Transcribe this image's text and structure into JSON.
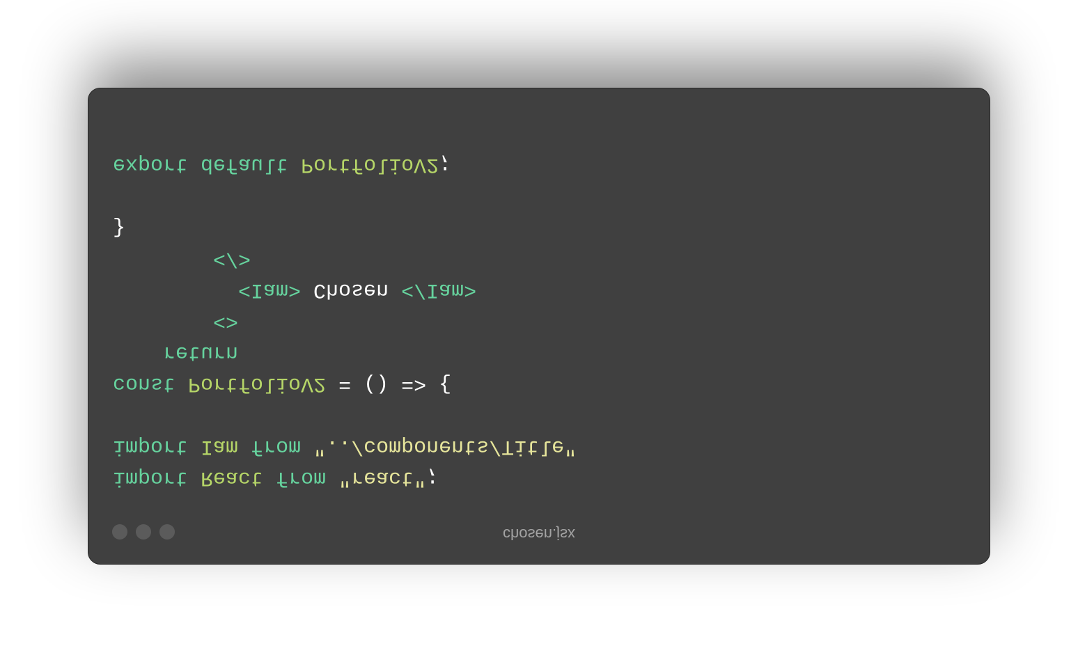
{
  "window": {
    "title": "chosen.jsx"
  },
  "code": {
    "lines": [
      [
        {
          "t": "import",
          "c": "k"
        },
        {
          "t": " "
        },
        {
          "t": "React",
          "c": "i"
        },
        {
          "t": " "
        },
        {
          "t": "from",
          "c": "k"
        },
        {
          "t": " "
        },
        {
          "t": "\"react\"",
          "c": "s"
        },
        {
          "t": ";",
          "c": "p"
        }
      ],
      [
        {
          "t": "import",
          "c": "k"
        },
        {
          "t": " "
        },
        {
          "t": "Iam",
          "c": "i"
        },
        {
          "t": " "
        },
        {
          "t": "from",
          "c": "k"
        },
        {
          "t": " "
        },
        {
          "t": "\"../components/Title\"",
          "c": "s"
        }
      ],
      [],
      [
        {
          "t": "const",
          "c": "k"
        },
        {
          "t": " "
        },
        {
          "t": "PortfolioV2",
          "c": "i"
        },
        {
          "t": " = () => {",
          "c": "p"
        }
      ],
      [
        {
          "t": "    "
        },
        {
          "t": "return",
          "c": "k"
        }
      ],
      [
        {
          "t": "        "
        },
        {
          "t": "<>",
          "c": "k"
        }
      ],
      [
        {
          "t": "          "
        },
        {
          "t": "<Iam>",
          "c": "k"
        },
        {
          "t": " Chosen ",
          "c": "p"
        },
        {
          "t": "</Iam>",
          "c": "k"
        }
      ],
      [
        {
          "t": "        "
        },
        {
          "t": "</>",
          "c": "k"
        }
      ],
      [
        {
          "t": "}",
          "c": "p"
        }
      ],
      [],
      [
        {
          "t": "export",
          "c": "k"
        },
        {
          "t": " "
        },
        {
          "t": "default",
          "c": "k"
        },
        {
          "t": " "
        },
        {
          "t": "PortfolioV2",
          "c": "i"
        },
        {
          "t": ";",
          "c": "p"
        }
      ]
    ]
  },
  "colors": {
    "background": "#404040",
    "keyword": "#66d39e",
    "identifier": "#b6d668",
    "string": "#e6e59b"
  }
}
